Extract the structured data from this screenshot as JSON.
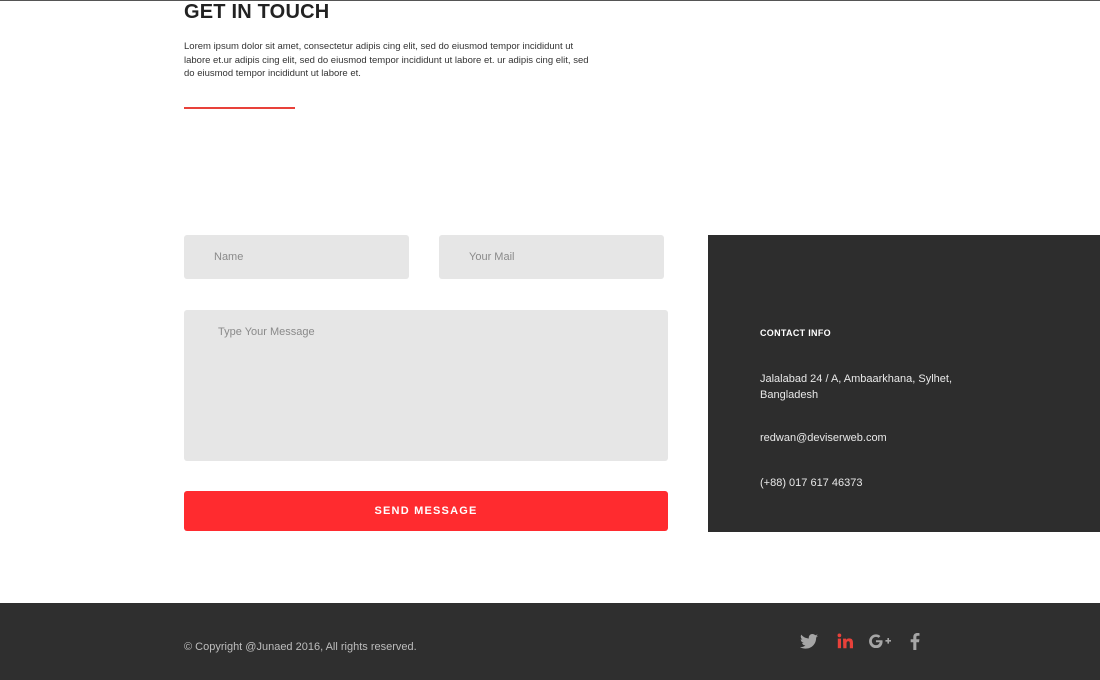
{
  "section": {
    "title": "GET IN TOUCH",
    "description": "Lorem ipsum dolor sit amet, consectetur adipis cing elit, sed do eiusmod tempor incididunt ut labore et.ur adipis cing elit, sed do eiusmod tempor incididunt ut labore et. ur adipis cing elit, sed do eiusmod tempor incididunt ut labore et."
  },
  "form": {
    "name_placeholder": "Name",
    "mail_placeholder": "Your Mail",
    "message_placeholder": "Type Your Message",
    "send_label": "SEND MESSAGE"
  },
  "contact": {
    "title": "CONTACT INFO",
    "address": "Jalalabad 24 / A, Ambaarkhana, Sylhet, Bangladesh",
    "email": "redwan@deviserweb.com",
    "phone": "(+88) 017 617 46373"
  },
  "footer": {
    "copyright": "© Copyright @Junaed 2016, All rights reserved.",
    "social_icons": [
      "twitter-icon",
      "linkedin-icon",
      "google-plus-icon",
      "facebook-icon"
    ]
  },
  "colors": {
    "accent": "#ff2b2f",
    "panel": "#2d2d2d",
    "field": "#e6e6e6",
    "icon_grey": "#a6a6a6",
    "linkedin_red": "#e8413a"
  }
}
